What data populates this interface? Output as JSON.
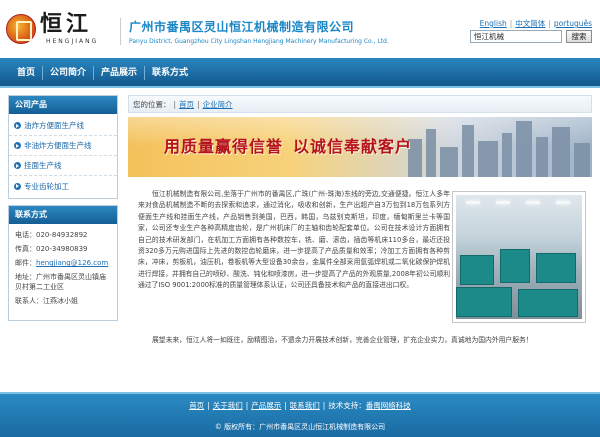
{
  "header": {
    "logo_cn": "恒江",
    "logo_en": "HENGJIANG",
    "company_name": "广州市番禺区灵山恒江机械制造有限公司",
    "company_address": "Panyu District, Guangzhou City Lingshan Hengjiang Machinery Manufacturing Co., Ltd.",
    "languages": [
      "English",
      "中文简体",
      "português"
    ],
    "search_value": "恒江机械",
    "search_button": "搜索"
  },
  "nav": {
    "items": [
      "首页",
      "公司简介",
      "产品展示",
      "联系方式"
    ]
  },
  "sidebar": {
    "products_title": "公司产品",
    "products": [
      "油炸方便面生产线",
      "非油炸方便面生产线",
      "挂面生产线",
      "专业齿轮加工"
    ],
    "contact_title": "联系方式",
    "contact": {
      "phone_label": "电话：",
      "phone": "020-84932892",
      "fax_label": "传真：",
      "fax": "020-34980839",
      "email_label": "邮件：",
      "email": "hengjiang@126.com",
      "address_label": "地址：",
      "address": "广州市番禺区灵山镇庙贝村第二工业区",
      "contact_label": "联系人：",
      "contact_person": "江燕冰小姐"
    }
  },
  "main": {
    "breadcrumb_label": "您的位置：",
    "breadcrumb": [
      "首页",
      "企业简介"
    ],
    "banner_part1": "用质量赢得信誉",
    "banner_part2": "以诚信奉献客户",
    "intro": "恒江机械制造有限公司,坐落于广州市的番禺区,广珠(广州-珠海)东线的旁边,交通便捷。恒江人多年来对食品机械制造不断的去探索和追求，通过消化，吸收和创新，生产出超产自3万包到18万包系列方便面生产线和挂面生产线，产品销售到美国，巴西，韩国，乌兹别克斯坦，印度，缅甸斯里兰卡等国家，公司还专业生产各种高精度齿轮，是广州机床厂的主轴和齿轮配套单位。公司在技术设计方面拥有自己的技术研发部门，在机加工方面拥有各种数控车，铣、磨、滚齿，插齿等机床110多台，最近还投资320多万元购进国际上先进的数控齿轮磨床，进一步提高了产品质量和效率；冷加工方面拥有各种剪床，冲床，剪板机，油压机，卷板机等大型设备30余台，金属件全部采用氩弧焊机或二氧化碳保护焊机进行焊接，并拥有自己的喷砂、酸洗、钝化和喷漆房，进一步提高了产品的外观质量,2008年初公司顺利通过了ISO 9001:2000标准的质量管理体系认证，公司还具备技术和产品的直接进出口权。",
    "closing": "展望未来，恒江人将一如既往，励精图治，不遗余力开展技术创新，完善企业管理，扩充企业实力，真诚地为国内外用户服务！"
  },
  "footer": {
    "links": [
      "首页",
      "关于我们",
      "产品展示",
      "联系我们"
    ],
    "tech_label": "技术支持：",
    "tech_link": "番禺网络科技",
    "copyright": "© 版权所有：广州市番禺区灵山恒江机械制造有限公司"
  },
  "colors": {
    "nav_blue": "#1a6aa3",
    "link_blue": "#1a6fb5",
    "banner_red": "#b5121b",
    "company_blue": "#1a86c6"
  }
}
